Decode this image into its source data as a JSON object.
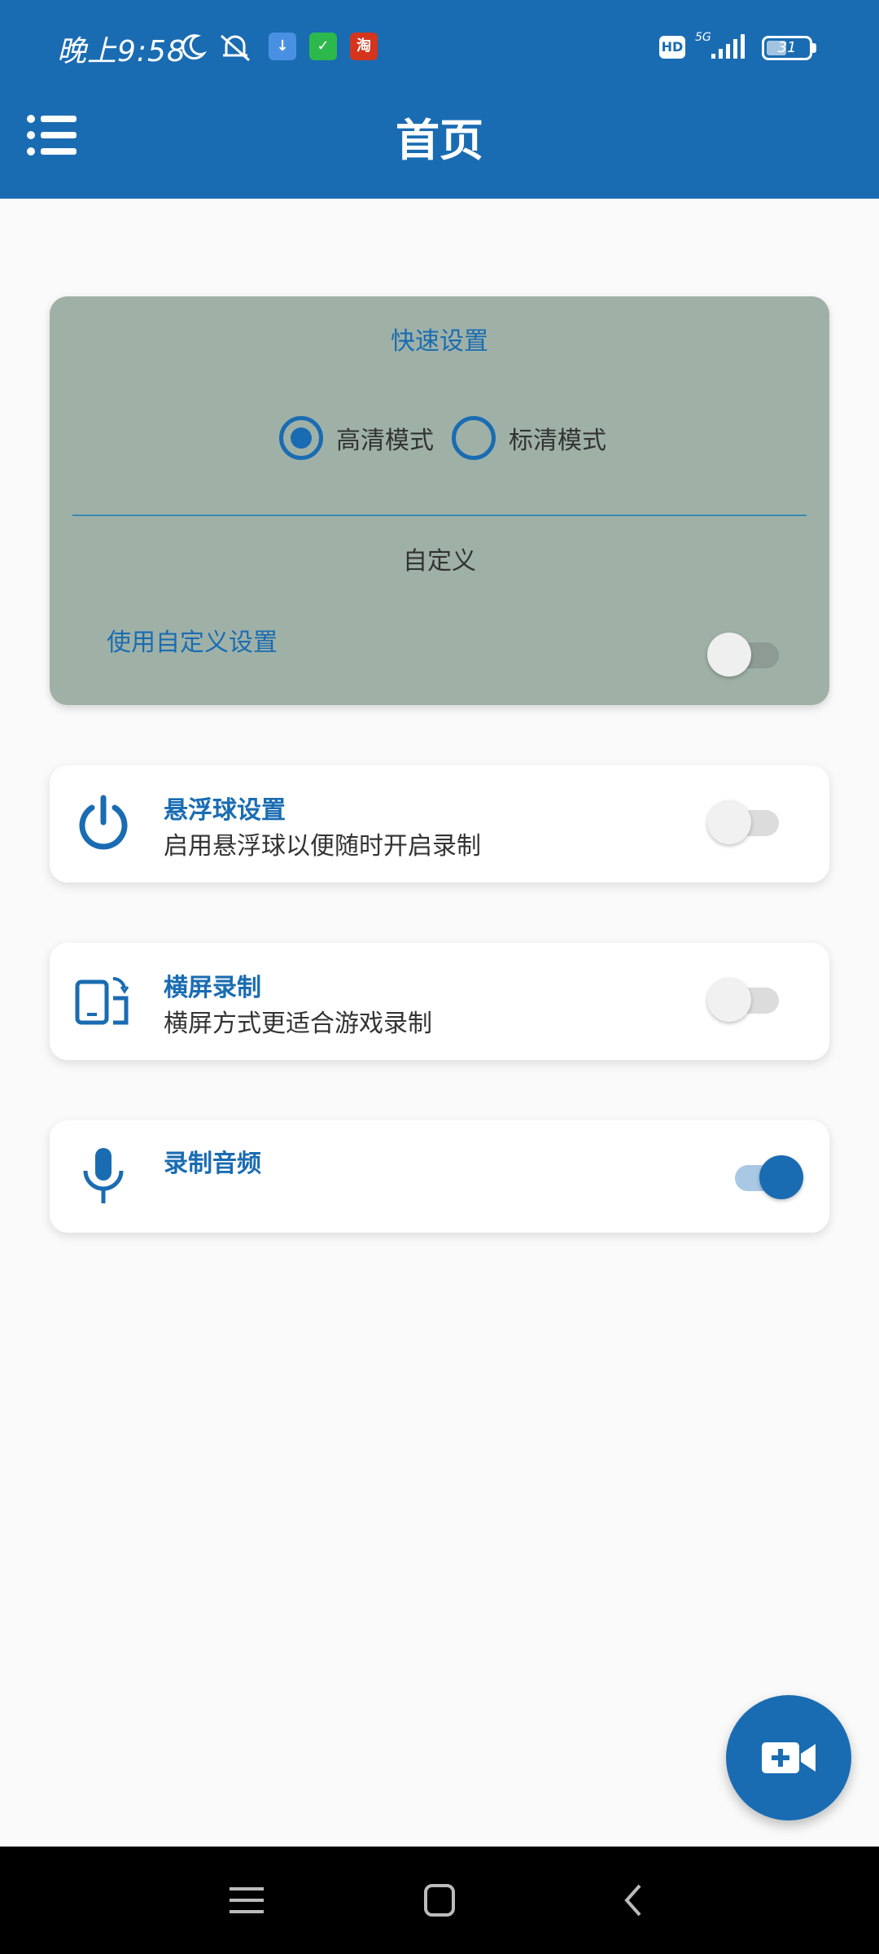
{
  "status_bar": {
    "time": "晚上9:58",
    "network": "5G",
    "hd_badge": "HD",
    "battery_level": "31",
    "taobao_badge": "淘"
  },
  "app_bar": {
    "title": "首页",
    "color": "#1a6cb2"
  },
  "quick_settings": {
    "title": "快速设置",
    "modes": [
      {
        "label": "高清模式",
        "selected": true
      },
      {
        "label": "标清模式",
        "selected": false
      }
    ],
    "custom_title": "自定义",
    "custom_toggle_label": "使用自定义设置",
    "custom_toggle_on": false,
    "background": "#9fb1a7"
  },
  "cards": [
    {
      "icon": "power-icon",
      "title": "悬浮球设置",
      "subtitle": "启用悬浮球以便随时开启录制",
      "enabled": false
    },
    {
      "icon": "rotate-screen-icon",
      "title": "横屏录制",
      "subtitle": "横屏方式更适合游戏录制",
      "enabled": false
    },
    {
      "icon": "microphone-icon",
      "title": "录制音频",
      "subtitle": "",
      "enabled": true
    }
  ],
  "fab": {
    "icon": "video-add-icon"
  },
  "nav_bar": {
    "icons": [
      "menu-lines-icon",
      "home-square-icon",
      "back-chevron-icon"
    ]
  }
}
